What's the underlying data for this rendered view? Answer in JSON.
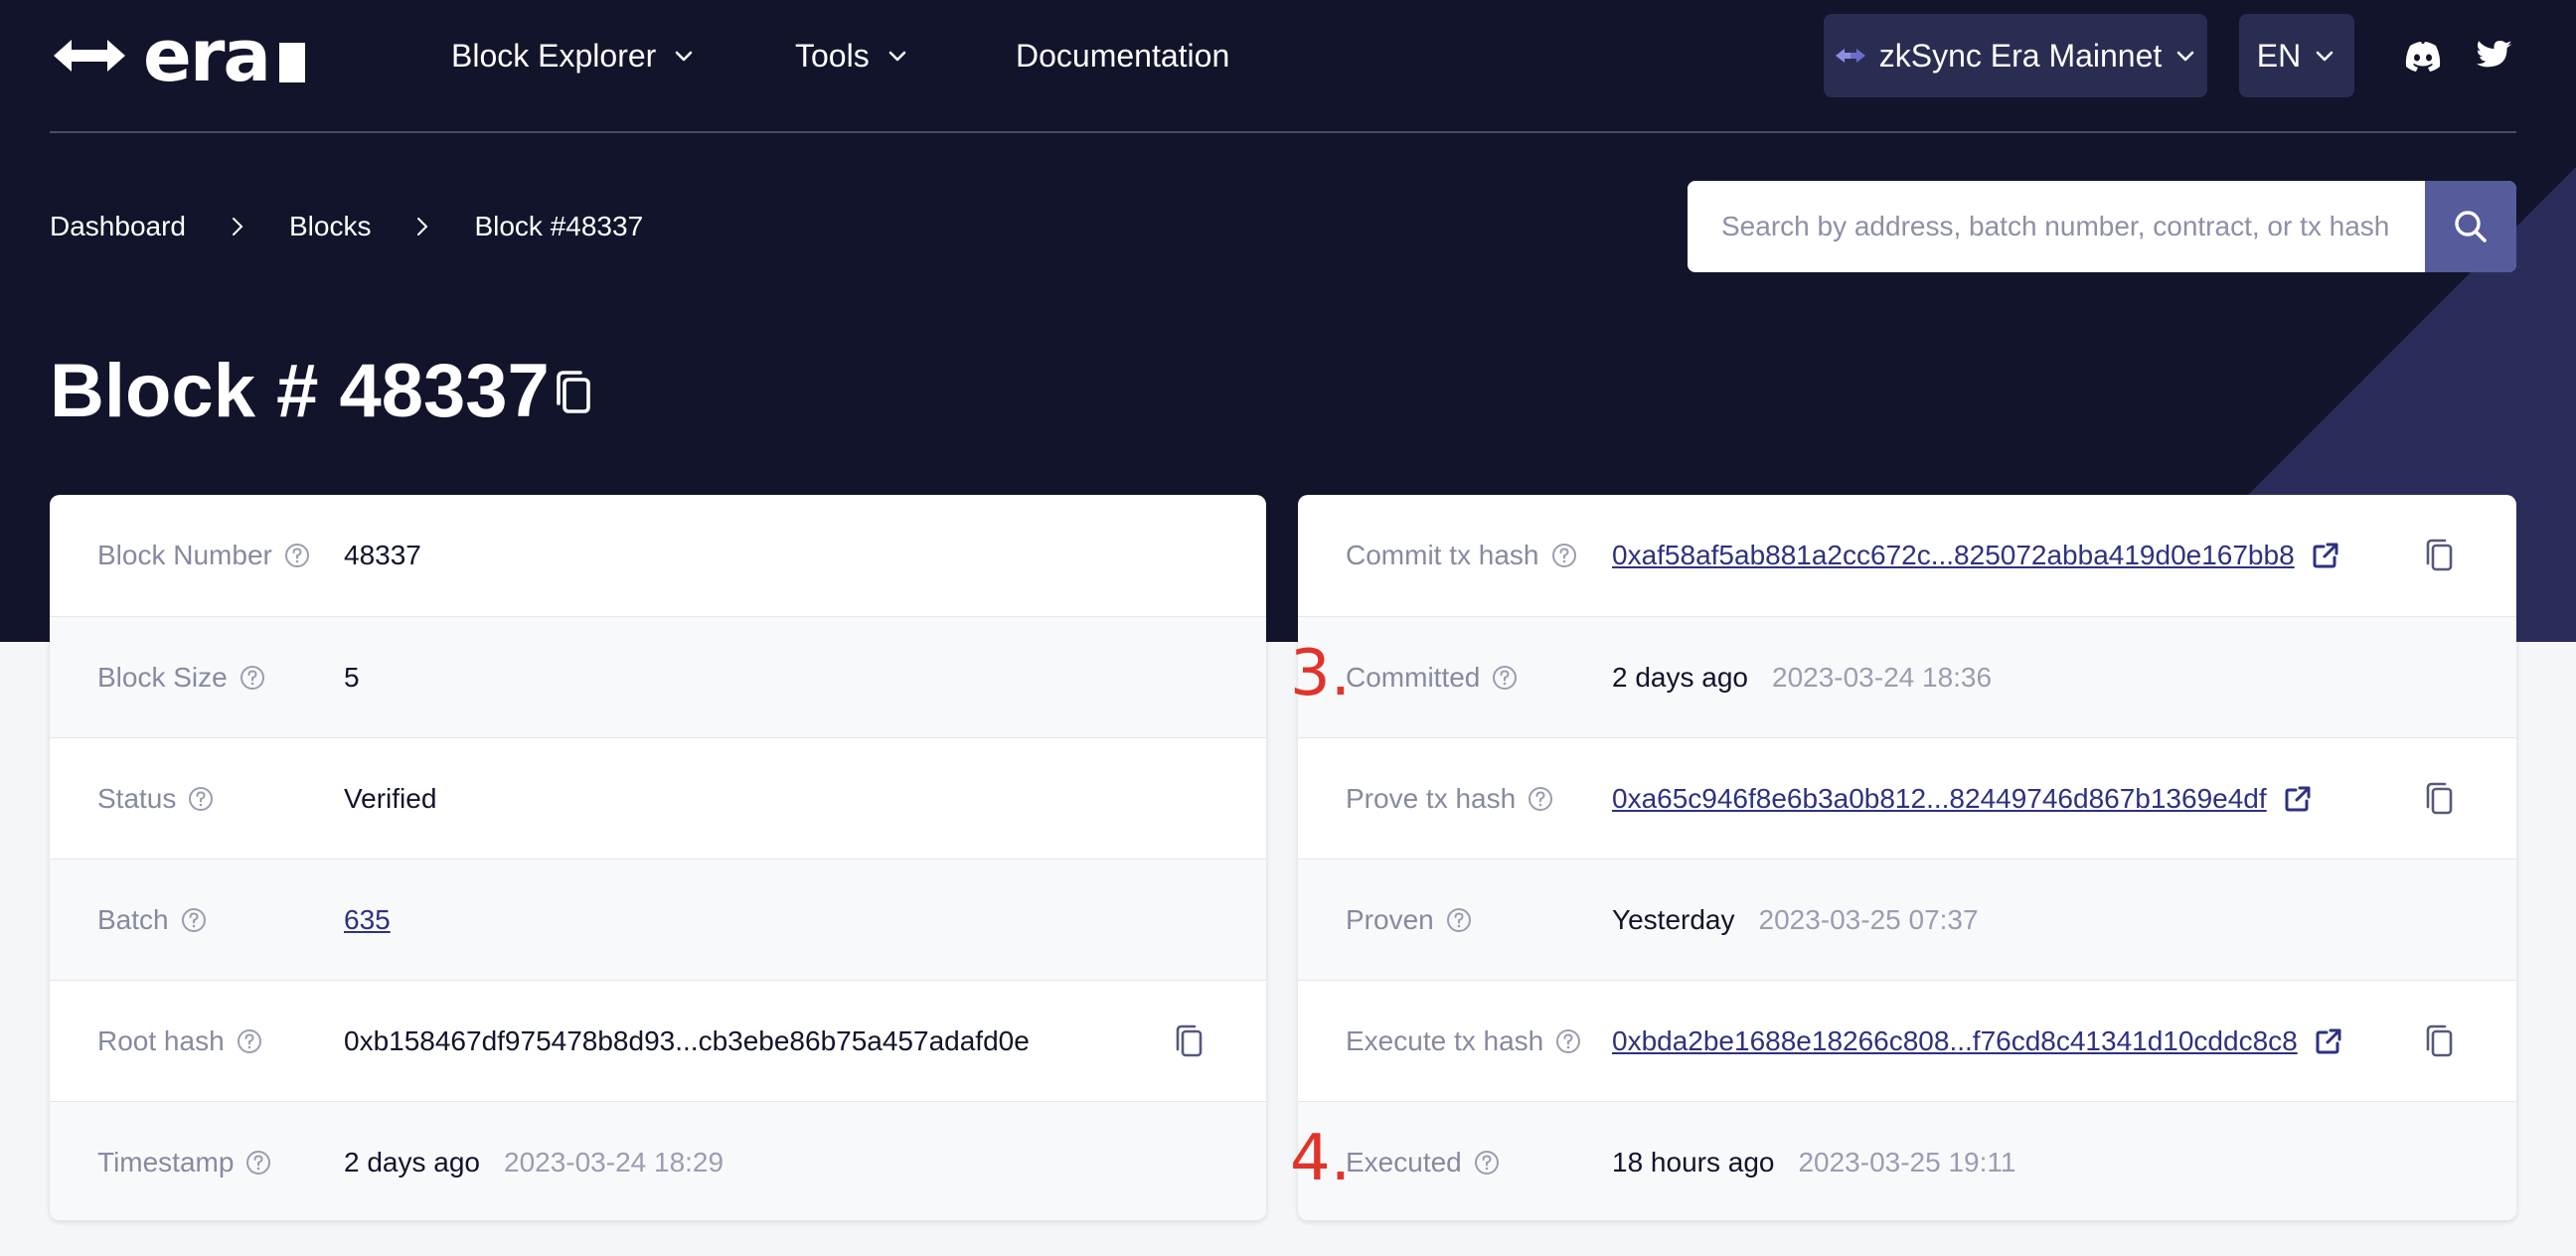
{
  "brand": {
    "logo_text": "era"
  },
  "nav": {
    "items": [
      {
        "label": "Block Explorer"
      },
      {
        "label": "Tools"
      },
      {
        "label": "Documentation"
      }
    ],
    "network": "zkSync Era Mainnet",
    "language": "EN"
  },
  "breadcrumb": [
    "Dashboard",
    "Blocks",
    "Block #48337"
  ],
  "search": {
    "placeholder": "Search by address, batch number, contract, or tx hash"
  },
  "page": {
    "title": "Block # 48337"
  },
  "left_card": {
    "rows": [
      {
        "label": "Block Number",
        "value": "48337"
      },
      {
        "label": "Block Size",
        "value": "5"
      },
      {
        "label": "Status",
        "value": "Verified"
      },
      {
        "label": "Batch",
        "value": "635"
      },
      {
        "label": "Root hash",
        "value": "0xb158467df975478b8d93...cb3ebe86b75a457adafd0e"
      },
      {
        "label": "Timestamp",
        "value": "2 days ago",
        "secondary": "2023-03-24 18:29"
      }
    ]
  },
  "right_card": {
    "rows": [
      {
        "label": "Commit tx hash",
        "value": "0xaf58af5ab881a2cc672c...825072abba419d0e167bb8"
      },
      {
        "label": "Committed",
        "value": "2 days ago",
        "secondary": "2023-03-24 18:36",
        "marker": "3."
      },
      {
        "label": "Prove tx hash",
        "value": "0xa65c946f8e6b3a0b812...82449746d867b1369e4df"
      },
      {
        "label": "Proven",
        "value": "Yesterday",
        "secondary": "2023-03-25 07:37"
      },
      {
        "label": "Execute tx hash",
        "value": "0xbda2be1688e18266c808...f76cd8c41341d10cddc8c8"
      },
      {
        "label": "Executed",
        "value": "18 hours ago",
        "secondary": "2023-03-25 19:11",
        "marker": "4."
      }
    ]
  },
  "colors": {
    "header_bg": "#11142b",
    "accent": "#565b9c",
    "link": "#2e3180",
    "marker": "#e0342a"
  }
}
